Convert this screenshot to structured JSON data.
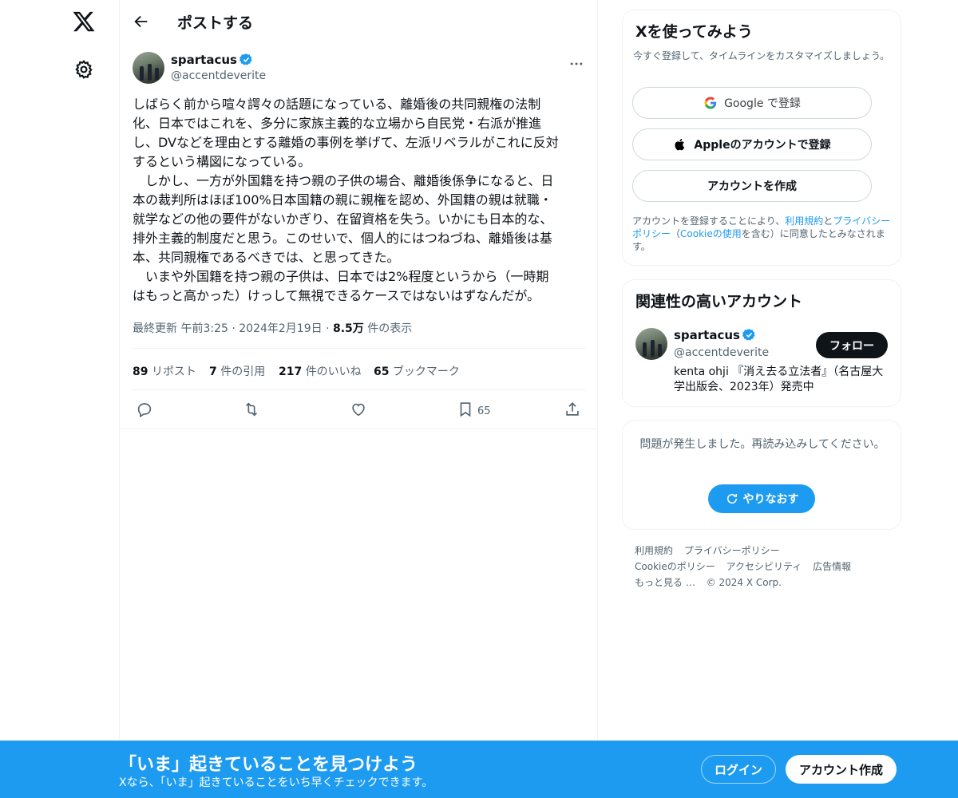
{
  "header": {
    "title": "ポストする"
  },
  "post": {
    "author_name": "spartacus",
    "author_handle": "@accentdeverite",
    "text": "しばらく前から喧々諤々の話題になっている、離婚後の共同親権の法制\n化、日本ではこれを、多分に家族主義的な立場から自民党・右派が推進\nし、DVなどを理由とする離婚の事例を挙げて、左派リベラルがこれに反対\nするという構図になっている。\n　しかし、一方が外国籍を持つ親の子供の場合、離婚後係争になると、日\n本の裁判所はほぼ100%日本国籍の親に親権を認め、外国籍の親は就職・\n就学などの他の要件がないかぎり、在留資格を失う。いかにも日本的な、\n排外主義的制度だと思う。このせいで、個人的にはつねづね、離婚後は基\n本、共同親権であるべきでは、と思ってきた。\n　いまや外国籍を持つ親の子供は、日本では2%程度というから（一時期\nはもっと高かった）けっして無視できるケースではないはずなんだが。",
    "updated_label": "最終更新 午前3:25",
    "date": "2024年2月19日",
    "dot": "·",
    "views_count": "8.5万",
    "views_label": "件の表示",
    "stats": {
      "reposts_count": "89",
      "reposts_label": "リポスト",
      "quotes_count": "7",
      "quotes_label": "件の引用",
      "likes_count": "217",
      "likes_label": "件のいいね",
      "bookmarks_count": "65",
      "bookmarks_label": "ブックマーク"
    },
    "bookmark_action_count": "65"
  },
  "signup_card": {
    "title": "Xを使ってみよう",
    "subtitle": "今すぐ登録して、タイムラインをカスタマイズしましょう。",
    "google_label": "Google で登録",
    "apple_label": "Appleのアカウントで登録",
    "create_label": "アカウントを作成",
    "legal_prefix": "アカウントを登録することにより、",
    "legal_terms": "利用規約",
    "legal_and": "と",
    "legal_privacy": "プライバシーポリシー",
    "legal_paren_open": "（",
    "legal_cookie": "Cookieの使用",
    "legal_suffix": "を含む）に同意したとみなされます。"
  },
  "related": {
    "title": "関連性の高いアカウント",
    "name": "spartacus",
    "handle": "@accentdeverite",
    "bio": "kenta ohji 『消え去る立法者』（名古屋大学出版会、2023年）発売中",
    "follow_label": "フォロー"
  },
  "error_card": {
    "message": "問題が発生しました。再読み込みしてください。",
    "retry_label": "やりなおす"
  },
  "footer": {
    "terms": "利用規約",
    "privacy": "プライバシーポリシー",
    "cookie": "Cookieのポリシー",
    "accessibility": "アクセシビリティ",
    "ads": "広告情報",
    "more": "もっと見る …",
    "copyright": "© 2024 X Corp."
  },
  "bottom_bar": {
    "title": "「いま」起きていることを見つけよう",
    "subtitle": "Xなら、「いま」起きていることをいち早くチェックできます。",
    "login_label": "ログイン",
    "signup_label": "アカウント作成"
  },
  "colors": {
    "accent": "#1d9bf0",
    "text": "#0f1419",
    "muted": "#536471",
    "border": "#eff3f4"
  },
  "icons": [
    "x-logo-icon",
    "gear-icon",
    "back-arrow-icon",
    "verified-icon",
    "more-icon",
    "reply-icon",
    "repost-icon",
    "like-icon",
    "bookmark-icon",
    "share-icon",
    "google-icon",
    "apple-icon",
    "refresh-icon"
  ]
}
